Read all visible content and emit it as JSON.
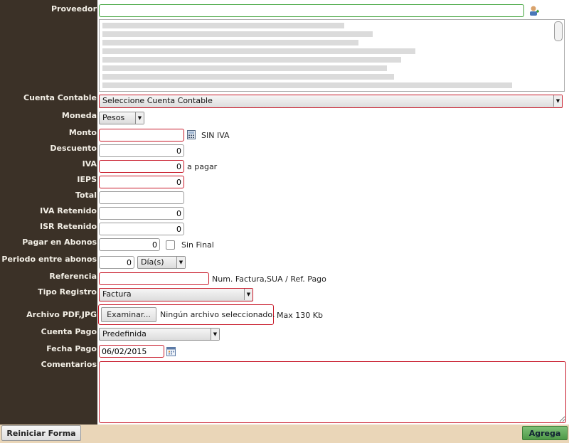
{
  "labels": {
    "proveedor": "Proveedor",
    "cuenta_contable": "Cuenta Contable",
    "moneda": "Moneda",
    "monto": "Monto",
    "descuento": "Descuento",
    "iva": "IVA",
    "ieps": "IEPS",
    "total": "Total",
    "iva_retenido": "IVA Retenido",
    "isr_retenido": "ISR Retenido",
    "pagar_en_abonos": "Pagar en Abonos",
    "periodo_abonos": "Periodo entre abonos",
    "referencia": "Referencia",
    "tipo_registro": "Tipo Registro",
    "archivo": "Archivo PDF,JPG",
    "cuenta_pago": "Cuenta Pago",
    "fecha_pago": "Fecha Pago",
    "comentarios": "Comentarios"
  },
  "fields": {
    "proveedor_value": "",
    "cuenta_contable_selected": "Seleccione Cuenta Contable",
    "moneda_selected": "Pesos",
    "monto_value": "",
    "monto_hint": "SIN IVA",
    "descuento_value": "0",
    "iva_value": "0",
    "iva_hint": "a pagar",
    "ieps_value": "0",
    "total_value": "",
    "iva_retenido_value": "0",
    "isr_retenido_value": "0",
    "abonos_value": "0",
    "sin_final_label": "Sin Final",
    "periodo_value": "0",
    "periodo_unit": "Día(s)",
    "referencia_value": "",
    "referencia_hint": "Num. Factura,SUA / Ref. Pago",
    "tipo_registro_selected": "Factura",
    "examinar_label": "Examinar...",
    "file_status": "Ningún archivo seleccionado.",
    "file_limit": "Max 130 Kb",
    "cuenta_pago_selected": "Predefinida",
    "fecha_pago_value": "06/02/2015",
    "comentarios_value": ""
  },
  "icons": {
    "proveedor": "add-user-icon",
    "monto": "calculator-icon",
    "fecha": "calendar-icon"
  },
  "buttons": {
    "reiniciar": "Reiniciar Forma",
    "agrega": "Agrega"
  },
  "colors": {
    "label_panel": "#3b3127",
    "required_border": "#c81a2a",
    "footer": "#ead6b8",
    "agrega_button": "#5ea857"
  }
}
